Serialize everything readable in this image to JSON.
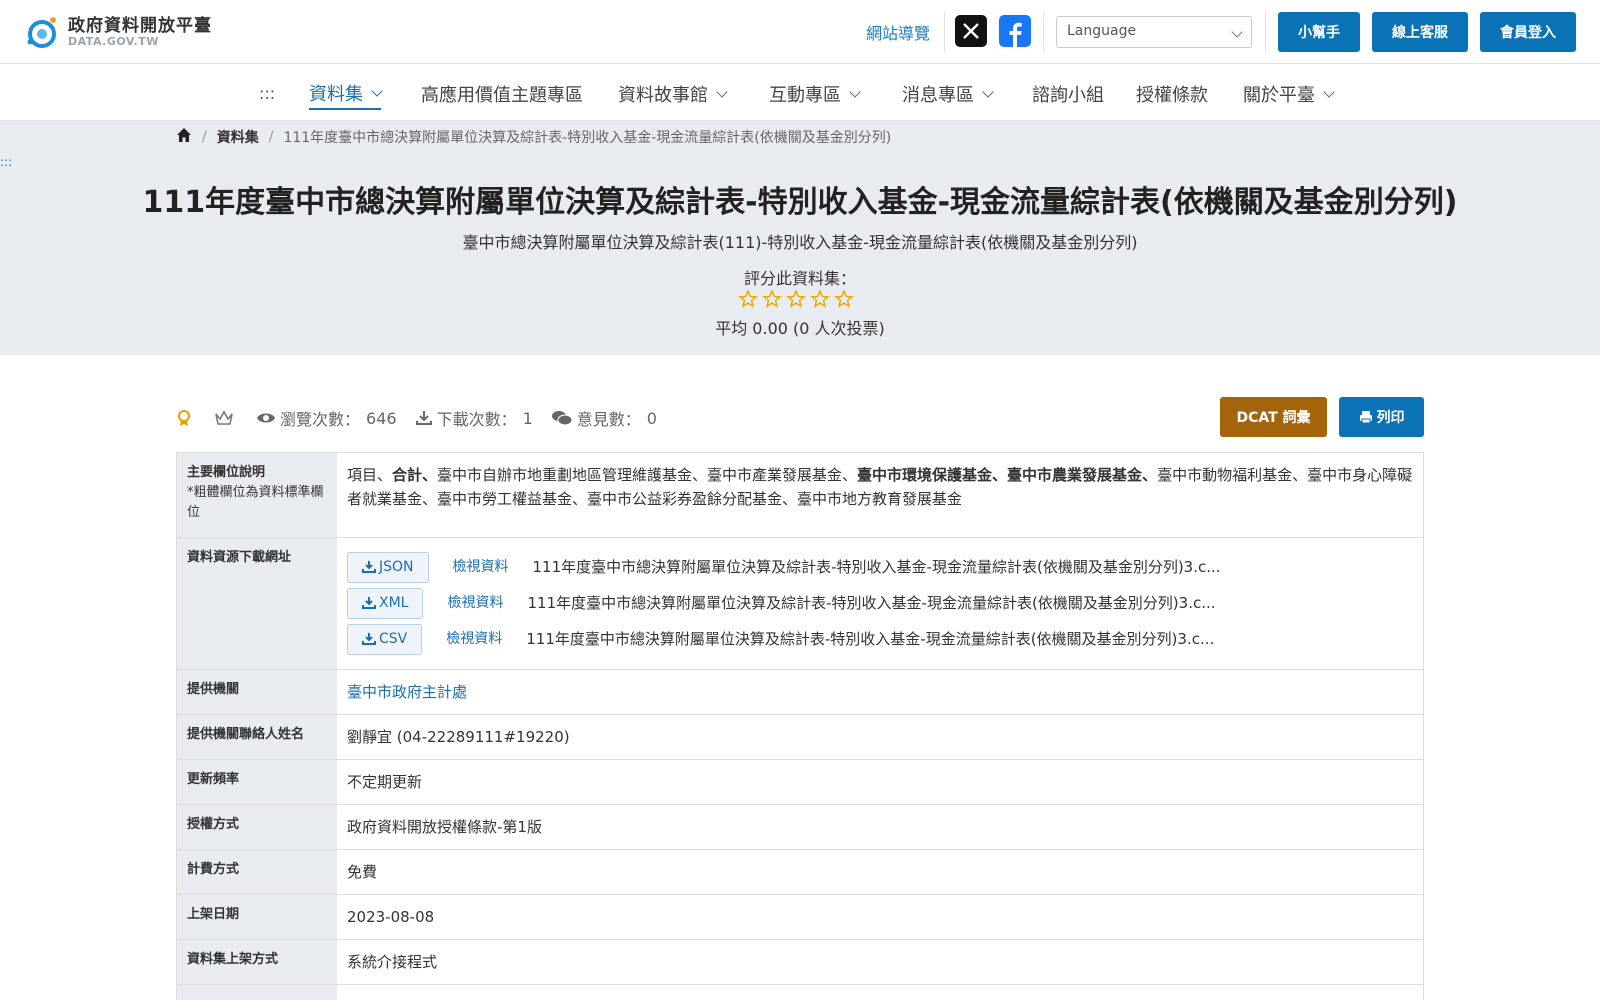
{
  "header": {
    "logo_zh": "政府資料開放平臺",
    "logo_en": "DATA.GOV.TW",
    "sitemap": "網站導覽",
    "language_placeholder": "Language",
    "buttons": [
      "小幫手",
      "線上客服",
      "會員登入"
    ]
  },
  "nav": {
    "dots": ":::",
    "items": [
      "資料集",
      "高應用價值主題專區",
      "資料故事館",
      "互動專區",
      "消息專區",
      "諮詢小組",
      "授權條款",
      "關於平臺"
    ]
  },
  "breadcrumb": {
    "home_icon": "home-icon",
    "items": [
      "資料集",
      "111年度臺中市總決算附屬單位決算及綜計表-特別收入基金-現金流量綜計表(依機關及基金別分列)"
    ]
  },
  "hero": {
    "dots": ":::",
    "title": "111年度臺中市總決算附屬單位決算及綜計表-特別收入基金-現金流量綜計表(依機關及基金別分列)",
    "subtitle": "臺中市總決算附屬單位決算及綜計表(111)-特別收入基金-現金流量綜計表(依機關及基金別分列)",
    "rate_label": "評分此資料集：",
    "rating": 0,
    "rating_max": 5,
    "average_text": "平均 0.00 (0 人次投票)"
  },
  "stats": {
    "views_label": "瀏覽次數：",
    "views": "646",
    "downloads_label": "下載次數：",
    "downloads": "1",
    "comments_label": "意見數：",
    "comments": "0"
  },
  "actions": {
    "dcat": "DCAT 詞彙",
    "print": "列印"
  },
  "table": {
    "main_fields_label": "主要欄位說明",
    "main_fields_note": "*粗體欄位為資料標準欄位",
    "main_fields": {
      "p1": "項目、",
      "b1": "合計、",
      "p2": "臺中市自辦市地重劃地區管理維護基金、臺中市產業發展基金、",
      "b2": "臺中市環境保護基金、臺中市農業發展基金、",
      "p3": "臺中市動物福利基金、臺中市身心障礙者就業基金、臺中市勞工權益基金、臺中市公益彩券盈餘分配基金、臺中市地方教育發展基金"
    },
    "download_label": "資料資源下載網址",
    "resources": [
      {
        "format": "JSON",
        "view": "檢視資料",
        "name": "111年度臺中市總決算附屬單位決算及綜計表-特別收入基金-現金流量綜計表(依機關及基金別分列)3.c..."
      },
      {
        "format": "XML",
        "view": "檢視資料",
        "name": "111年度臺中市總決算附屬單位決算及綜計表-特別收入基金-現金流量綜計表(依機關及基金別分列)3.c..."
      },
      {
        "format": "CSV",
        "view": "檢視資料",
        "name": "111年度臺中市總決算附屬單位決算及綜計表-特別收入基金-現金流量綜計表(依機關及基金別分列)3.c..."
      }
    ],
    "rows": [
      {
        "label": "提供機關",
        "value": "臺中市政府主計處"
      },
      {
        "label": "提供機關聯絡人姓名",
        "value": "劉靜宜 (04-22289111#19220)"
      },
      {
        "label": "更新頻率",
        "value": "不定期更新"
      },
      {
        "label": "授權方式",
        "value": "政府資料開放授權條款-第1版"
      },
      {
        "label": "計費方式",
        "value": "免費"
      },
      {
        "label": "上架日期",
        "value": "2023-08-08"
      },
      {
        "label": "資料集上架方式",
        "value": "系統介接程式"
      }
    ]
  },
  "colors": {
    "primary": "#0b72b5",
    "dcat": "#a4640c",
    "hero_bg": "#e8ecf1",
    "star": "#e8a800"
  }
}
